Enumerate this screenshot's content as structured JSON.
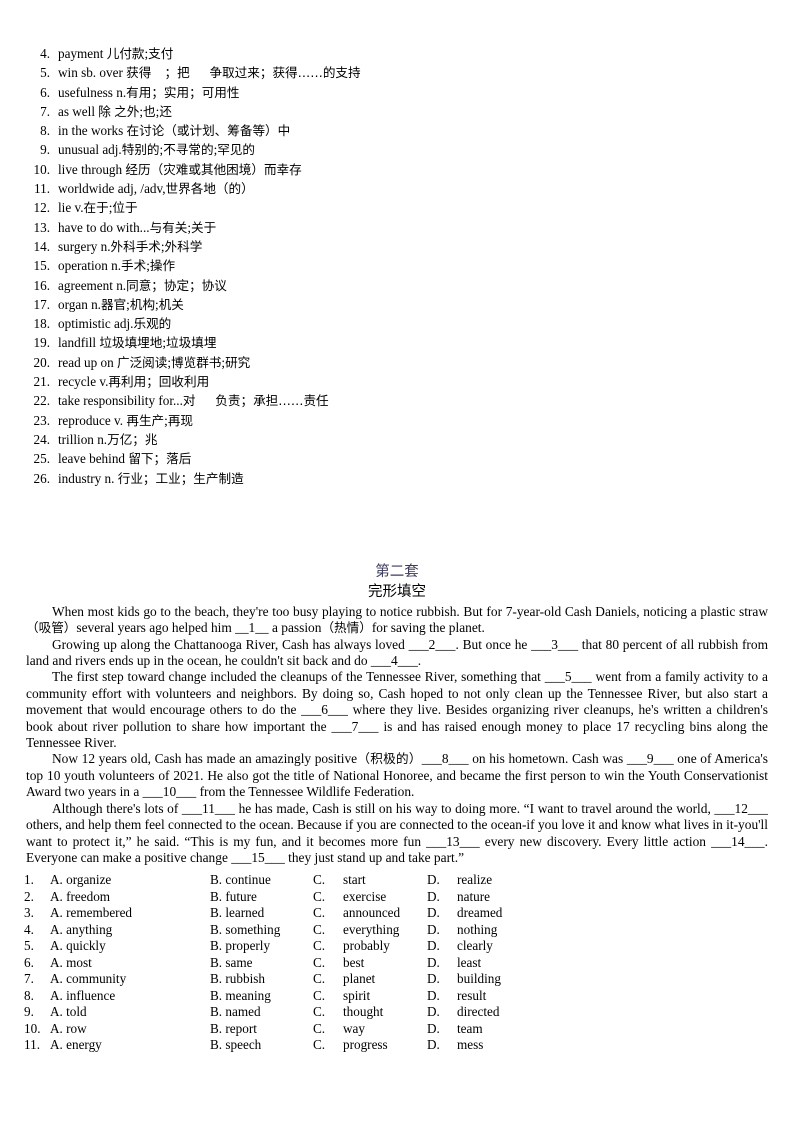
{
  "vocabulary": {
    "items": [
      {
        "num": "4.",
        "text": "payment 儿付款;支付"
      },
      {
        "num": "5.",
        "text": "win sb. over 获得    ；把      争取过来；获得……的支持"
      },
      {
        "num": "6.",
        "text": "usefulness n.有用；实用；可用性"
      },
      {
        "num": "7.",
        "text": "as well 除 之外;也;还"
      },
      {
        "num": "8.",
        "text": "in the works 在讨论（或计划、筹备等）中"
      },
      {
        "num": "9.",
        "text": "unusual adj.特别的;不寻常的;罕见的"
      },
      {
        "num": "10.",
        "text": "live through 经历（灾难或其他困境）而幸存"
      },
      {
        "num": "11.",
        "text": "worldwide adj, /adv,世界各地（的）"
      },
      {
        "num": "12.",
        "text": "lie v.在于;位于"
      },
      {
        "num": "13.",
        "text": "have to do with...与有关;关于"
      },
      {
        "num": "14.",
        "text": "surgery n.外科手术;外科学"
      },
      {
        "num": "15.",
        "text": "operation n.手术;操作"
      },
      {
        "num": "16.",
        "text": "agreement n.同意；协定；协议"
      },
      {
        "num": "17.",
        "text": "organ n.器官;机构;机关"
      },
      {
        "num": "18.",
        "text": "optimistic adj.乐观的"
      },
      {
        "num": "19.",
        "text": "landfill 垃圾填埋地;垃圾填埋"
      },
      {
        "num": "20.",
        "text": "read up on 广泛阅读;博览群书;研究"
      },
      {
        "num": "21.",
        "text": "recycle v.再利用；回收利用"
      },
      {
        "num": "22.",
        "text": "take responsibility for...对      负责；承担……责任"
      },
      {
        "num": "23.",
        "text": "reproduce v. 再生产;再现"
      },
      {
        "num": "24.",
        "text": "trillion n.万亿；兆"
      },
      {
        "num": "25.",
        "text": "leave behind 留下；落后"
      },
      {
        "num": "26.",
        "text": "industry n. 行业；工业；生产制造"
      }
    ]
  },
  "section": {
    "title": "第二套",
    "subtitle": "完形填空"
  },
  "passage": {
    "paragraphs": [
      "When most kids go to the beach, they're too busy playing to notice rubbish. But for 7-year-old Cash Daniels, noticing a plastic straw（吸管）several years ago helped him __1__ a passion（热情）for saving the planet.",
      "Growing up along the Chattanooga River, Cash has always loved ___2___. But once he ___3___ that 80 percent of all rubbish from land and rivers ends up in the ocean, he couldn't sit back and do ___4___.",
      "The first step toward change included the cleanups of the Tennessee River, something that ___5___ went from a family activity to a community effort with volunteers and neighbors. By doing so, Cash hoped to not only clean up the Tennessee River, but also start a movement that would encourage others to do the ___6___ where they live. Besides organizing river cleanups, he's written a children's book about river pollution to share how important the ___7___ is and has raised enough money to place 17 recycling bins along the Tennessee River.",
      "Now 12 years old, Cash has made an amazingly positive（积极的）___8___ on his hometown. Cash was ___9___ one of America's top 10 youth volunteers of 2021. He also got the title of National Honoree, and became the first person to win the Youth Conservationist Award two years in a ___10___ from the Tennessee Wildlife Federation.",
      "Although there's lots of ___11___ he has made, Cash is still on his way to doing more. “I want to travel around the world, ___12___ others, and help them feel connected to the ocean. Because if you are connected to the ocean-if you love it and know what lives in it-you'll want to protect it,” he said. “This is my fun, and it becomes more fun ___13___ every new discovery. Every little action ___14___. Everyone can make a positive change ___15___ they just stand up and take part.”"
    ]
  },
  "options": {
    "rows": [
      {
        "idx": "1.",
        "a": "A. organize",
        "b": "B. continue",
        "c": "C.",
        "c_text": "start",
        "d": "D.",
        "d_text": "realize"
      },
      {
        "idx": "2.",
        "a": "A. freedom",
        "b": "B. future",
        "c": "C.",
        "c_text": "exercise",
        "d": "D.",
        "d_text": "nature"
      },
      {
        "idx": "3.",
        "a": "A. remembered",
        "b": "B. learned",
        "c": "C.",
        "c_text": "announced",
        "d": "D.",
        "d_text": "dreamed"
      },
      {
        "idx": "4.",
        "a": "A. anything",
        "b": "B. something",
        "c": "C.",
        "c_text": "everything",
        "d": "D.",
        "d_text": "nothing"
      },
      {
        "idx": "5.",
        "a": "A. quickly",
        "b": "B. properly",
        "c": "C.",
        "c_text": "probably",
        "d": "D.",
        "d_text": "clearly"
      },
      {
        "idx": "6.",
        "a": "A. most",
        "b": "B. same",
        "c": "C.",
        "c_text": "best",
        "d": "D.",
        "d_text": "least"
      },
      {
        "idx": "7.",
        "a": "A. community",
        "b": "B. rubbish",
        "c": "C.",
        "c_text": "planet",
        "d": "D.",
        "d_text": "building"
      },
      {
        "idx": "8.",
        "a": "A. influence",
        "b": "B. meaning",
        "c": "C.",
        "c_text": "spirit",
        "d": "D.",
        "d_text": "result"
      },
      {
        "idx": "9.",
        "a": "A. told",
        "b": "B. named",
        "c": "C.",
        "c_text": "thought",
        "d": "D.",
        "d_text": "directed"
      },
      {
        "idx": "10.",
        "a": "A. row",
        "b": "B. report",
        "c": "C.",
        "c_text": "way",
        "d": "D.",
        "d_text": "team"
      },
      {
        "idx": "11.",
        "a": "A. energy",
        "b": "B. speech",
        "c": "C.",
        "c_text": "progress",
        "d": "D.",
        "d_text": "mess"
      }
    ]
  }
}
